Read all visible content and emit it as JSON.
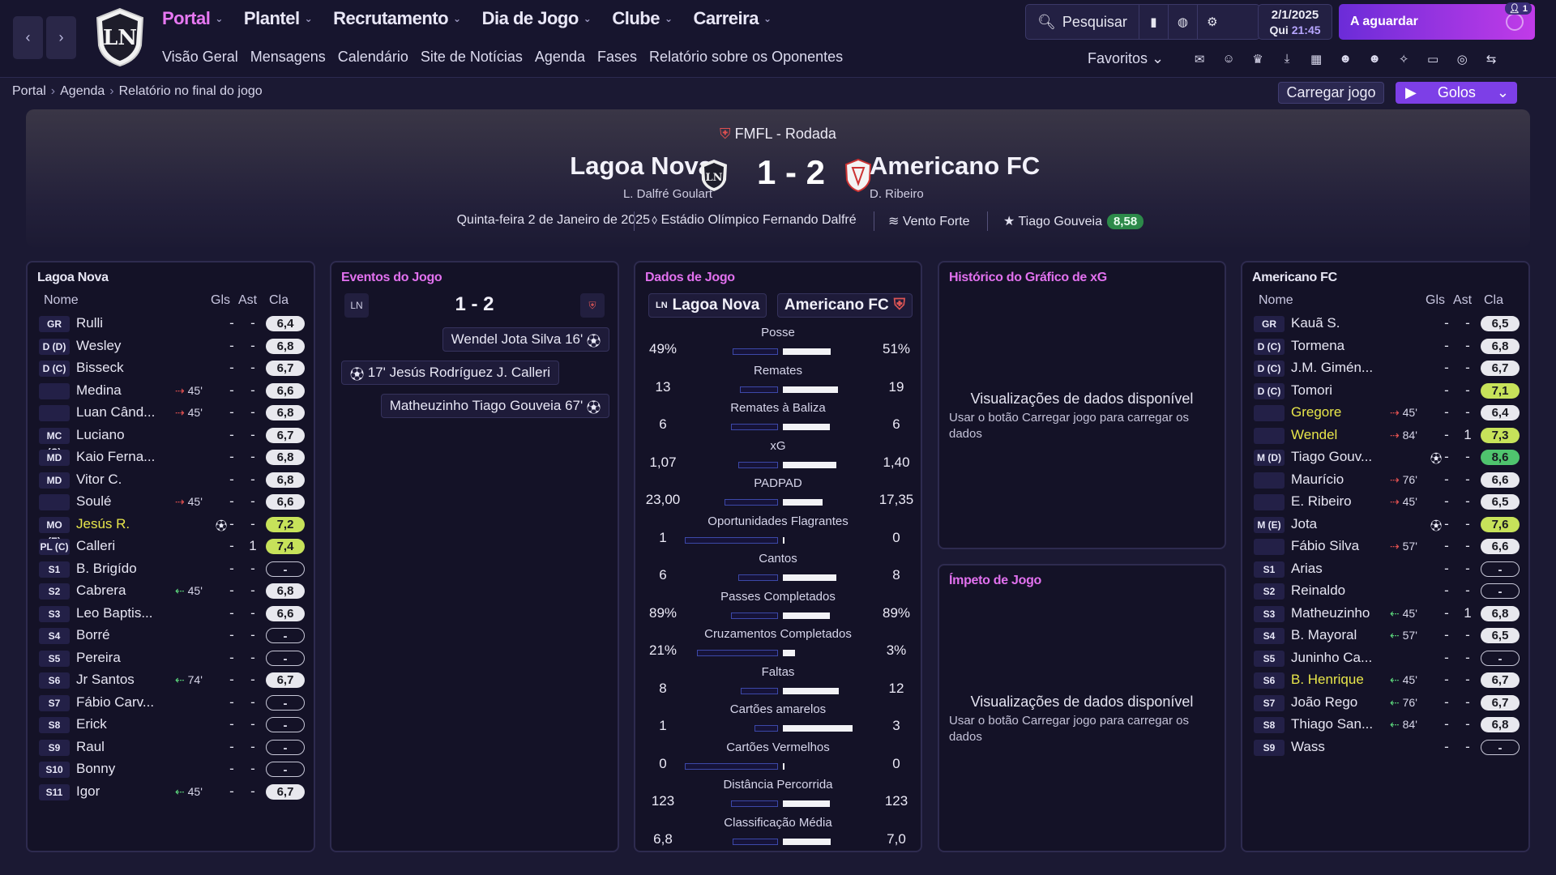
{
  "nav": {
    "back_icon": "chevron-left-icon",
    "forward_icon": "chevron-right-icon",
    "main": [
      "Portal",
      "Plantel",
      "Recrutamento",
      "Dia de Jogo",
      "Clube",
      "Carreira"
    ],
    "sub": [
      "Visão Geral",
      "Mensagens",
      "Calendário",
      "Site de Notícias",
      "Agenda",
      "Fases",
      "Relatório sobre os Oponentes"
    ],
    "search": "Pesquisar",
    "date": "2/1/2025",
    "weekday": "Qui",
    "time": "21:45",
    "continue": "A aguardar",
    "inbox_count": "1",
    "favorites": "Favoritos"
  },
  "breadcrumb": [
    "Portal",
    "Agenda",
    "Relatório no final do jogo"
  ],
  "actions": {
    "load_match": "Carregar jogo",
    "goals": "Golos"
  },
  "match": {
    "competition": "FMFL - Rodada",
    "home": "Lagoa Nova",
    "home_manager": "L. Dalfré Goulart",
    "away": "Americano FC",
    "away_manager": "D. Ribeiro",
    "score": "1 - 2",
    "date": "Quinta-feira 2 de Janeiro de 2025",
    "stadium": "Estádio Olímpico Fernando Dalfré",
    "weather": "Vento Forte",
    "motm": "Tiago Gouveia",
    "motm_rating": "8,58"
  },
  "cols": {
    "name": "Nome",
    "goals": "Gls",
    "assists": "Ast",
    "rating": "Cla"
  },
  "home_panel": {
    "title": "Lagoa Nova",
    "players": [
      {
        "pos": "GR",
        "name": "Rulli",
        "sub": "",
        "g": "-",
        "a": "-",
        "r": "6,4"
      },
      {
        "pos": "D (D)",
        "name": "Wesley",
        "sub": "",
        "g": "-",
        "a": "-",
        "r": "6,8"
      },
      {
        "pos": "D (C)",
        "name": "Bisseck",
        "sub": "",
        "g": "-",
        "a": "-",
        "r": "6,7"
      },
      {
        "pos": "",
        "name": "Medina",
        "sub": "45'",
        "g": "-",
        "a": "-",
        "r": "6,6"
      },
      {
        "pos": "",
        "name": "Luan Când...",
        "sub": "45'",
        "g": "-",
        "a": "-",
        "r": "6,8"
      },
      {
        "pos": "MC (C)",
        "name": "Luciano",
        "sub": "",
        "g": "-",
        "a": "-",
        "r": "6,7"
      },
      {
        "pos": "MD",
        "name": "Kaio Ferna...",
        "sub": "",
        "g": "-",
        "a": "-",
        "r": "6,8"
      },
      {
        "pos": "MD",
        "name": "Vitor C.",
        "sub": "",
        "g": "-",
        "a": "-",
        "r": "6,8"
      },
      {
        "pos": "",
        "name": "Soulé",
        "sub": "45'",
        "g": "-",
        "a": "-",
        "r": "6,6"
      },
      {
        "pos": "MO (E)",
        "name": "Jesús R.",
        "sub": "",
        "g": "-",
        "a": "-",
        "r": "7,2"
      },
      {
        "pos": "PL (C)",
        "name": "Calleri",
        "sub": "",
        "g": "-",
        "a": "1",
        "r": "7,4"
      },
      {
        "pos": "S1",
        "name": "B. Brigído",
        "sub": "",
        "g": "-",
        "a": "-",
        "r": "-"
      },
      {
        "pos": "S2",
        "name": "Cabrera",
        "sub": "45'",
        "g": "-",
        "a": "-",
        "r": "6,8"
      },
      {
        "pos": "S3",
        "name": "Leo Baptis...",
        "sub": "",
        "g": "-",
        "a": "-",
        "r": "6,6"
      },
      {
        "pos": "S4",
        "name": "Borré",
        "sub": "",
        "g": "-",
        "a": "-",
        "r": "-"
      },
      {
        "pos": "S5",
        "name": "Pereira",
        "sub": "",
        "g": "-",
        "a": "-",
        "r": "-"
      },
      {
        "pos": "S6",
        "name": "Jr Santos",
        "sub": "74'",
        "g": "-",
        "a": "-",
        "r": "6,7"
      },
      {
        "pos": "S7",
        "name": "Fábio Carv...",
        "sub": "",
        "g": "-",
        "a": "-",
        "r": "-"
      },
      {
        "pos": "S8",
        "name": "Erick",
        "sub": "",
        "g": "-",
        "a": "-",
        "r": "-"
      },
      {
        "pos": "S9",
        "name": "Raul",
        "sub": "",
        "g": "-",
        "a": "-",
        "r": "-"
      },
      {
        "pos": "S10",
        "name": "Bonny",
        "sub": "",
        "g": "-",
        "a": "-",
        "r": "-"
      },
      {
        "pos": "S11",
        "name": "Igor",
        "sub": "45'",
        "g": "-",
        "a": "-",
        "r": "6,7"
      }
    ]
  },
  "away_panel": {
    "title": "Americano FC",
    "players": [
      {
        "pos": "GR",
        "name": "Kauã S.",
        "sub": "",
        "g": "-",
        "a": "-",
        "r": "6,5"
      },
      {
        "pos": "D (C)",
        "name": "Tormena",
        "sub": "",
        "g": "-",
        "a": "-",
        "r": "6,8"
      },
      {
        "pos": "D (C)",
        "name": "J.M. Gimén...",
        "sub": "",
        "g": "-",
        "a": "-",
        "r": "6,7"
      },
      {
        "pos": "D (C)",
        "name": "Tomori",
        "sub": "",
        "g": "-",
        "a": "-",
        "r": "7,1"
      },
      {
        "pos": "",
        "name": "Gregore",
        "sub": "45'",
        "g": "-",
        "a": "-",
        "r": "6,4"
      },
      {
        "pos": "",
        "name": "Wendel",
        "sub": "84'",
        "g": "-",
        "a": "1",
        "r": "7,3"
      },
      {
        "pos": "M (D)",
        "name": "Tiago Gouv...",
        "sub": "",
        "g": "-",
        "a": "-",
        "r": "8,6"
      },
      {
        "pos": "",
        "name": "Maurício",
        "sub": "76'",
        "g": "-",
        "a": "-",
        "r": "6,6"
      },
      {
        "pos": "",
        "name": "E. Ribeiro",
        "sub": "45'",
        "g": "-",
        "a": "-",
        "r": "6,5"
      },
      {
        "pos": "M (E)",
        "name": "Jota",
        "sub": "",
        "g": "-",
        "a": "-",
        "r": "7,6"
      },
      {
        "pos": "",
        "name": "Fábio Silva",
        "sub": "57'",
        "g": "-",
        "a": "-",
        "r": "6,6"
      },
      {
        "pos": "S1",
        "name": "Arias",
        "sub": "",
        "g": "-",
        "a": "-",
        "r": "-"
      },
      {
        "pos": "S2",
        "name": "Reinaldo",
        "sub": "",
        "g": "-",
        "a": "-",
        "r": "-"
      },
      {
        "pos": "S3",
        "name": "Matheuzinho",
        "sub": "45'",
        "g": "-",
        "a": "1",
        "r": "6,8"
      },
      {
        "pos": "S4",
        "name": "B. Mayoral",
        "sub": "57'",
        "g": "-",
        "a": "-",
        "r": "6,5"
      },
      {
        "pos": "S5",
        "name": "Juninho Ca...",
        "sub": "",
        "g": "-",
        "a": "-",
        "r": "-"
      },
      {
        "pos": "S6",
        "name": "B. Henrique",
        "sub": "45'",
        "g": "-",
        "a": "-",
        "r": "6,7"
      },
      {
        "pos": "S7",
        "name": "João Rego",
        "sub": "76'",
        "g": "-",
        "a": "-",
        "r": "6,7"
      },
      {
        "pos": "S8",
        "name": "Thiago San...",
        "sub": "84'",
        "g": "-",
        "a": "-",
        "r": "6,8"
      },
      {
        "pos": "S9",
        "name": "Wass",
        "sub": "",
        "g": "-",
        "a": "-",
        "r": "-"
      }
    ]
  },
  "events": {
    "title": "Eventos do Jogo",
    "score": "1 - 2",
    "items": [
      {
        "text": "Wendel  Jota Silva 16'",
        "side": "away"
      },
      {
        "text": "17'  Jesús Rodríguez  J. Calleri",
        "side": "home"
      },
      {
        "text": "Matheuzinho  Tiago Gouveia 67'",
        "side": "away"
      }
    ]
  },
  "stats": {
    "title": "Dados de Jogo",
    "home": "Lagoa Nova",
    "away": "Americano FC",
    "rows": [
      {
        "label": "Posse",
        "home": "49%",
        "away": "51%",
        "h": 0.49,
        "a": 0.51
      },
      {
        "label": "Remates",
        "home": "13",
        "away": "19",
        "h": 0.41,
        "a": 0.59
      },
      {
        "label": "Remates à Baliza",
        "home": "6",
        "away": "6",
        "h": 0.5,
        "a": 0.5
      },
      {
        "label": "xG",
        "home": "1,07",
        "away": "1,40",
        "h": 0.43,
        "a": 0.57
      },
      {
        "label": "PADPAD",
        "home": "23,00",
        "away": "17,35",
        "h": 0.57,
        "a": 0.43
      },
      {
        "label": "Oportunidades Flagrantes",
        "home": "1",
        "away": "0",
        "h": 1.0,
        "a": 0.0
      },
      {
        "label": "Cantos",
        "home": "6",
        "away": "8",
        "h": 0.43,
        "a": 0.57
      },
      {
        "label": "Passes Completados",
        "home": "89%",
        "away": "89%",
        "h": 0.5,
        "a": 0.5
      },
      {
        "label": "Cruzamentos Completados",
        "home": "21%",
        "away": "3%",
        "h": 0.87,
        "a": 0.13
      },
      {
        "label": "Faltas",
        "home": "8",
        "away": "12",
        "h": 0.4,
        "a": 0.6
      },
      {
        "label": "Cartões amarelos",
        "home": "1",
        "away": "3",
        "h": 0.25,
        "a": 0.75
      },
      {
        "label": "Cartões Vermelhos",
        "home": "0",
        "away": "0",
        "h": 1.0,
        "a": 0.0
      },
      {
        "label": "Distância Percorrida",
        "home": "123",
        "away": "123",
        "h": 0.5,
        "a": 0.5
      },
      {
        "label": "Classificação Média",
        "home": "6,8",
        "away": "7,0",
        "h": 0.49,
        "a": 0.51
      }
    ]
  },
  "xg_panel": {
    "title": "Histórico do Gráfico de xG",
    "empty": "Visualizações de dados disponível",
    "hint": "Usar o botão Carregar jogo para carregar os dados"
  },
  "momentum_panel": {
    "title": "Ímpeto de Jogo",
    "empty": "Visualizações de dados disponível",
    "hint": "Usar o botão Carregar jogo para carregar os dados"
  },
  "colors": {
    "accent": "#e271ef",
    "purple": "#7d3fe7",
    "good": "#c7e25a",
    "vgood": "#4fc46e"
  }
}
